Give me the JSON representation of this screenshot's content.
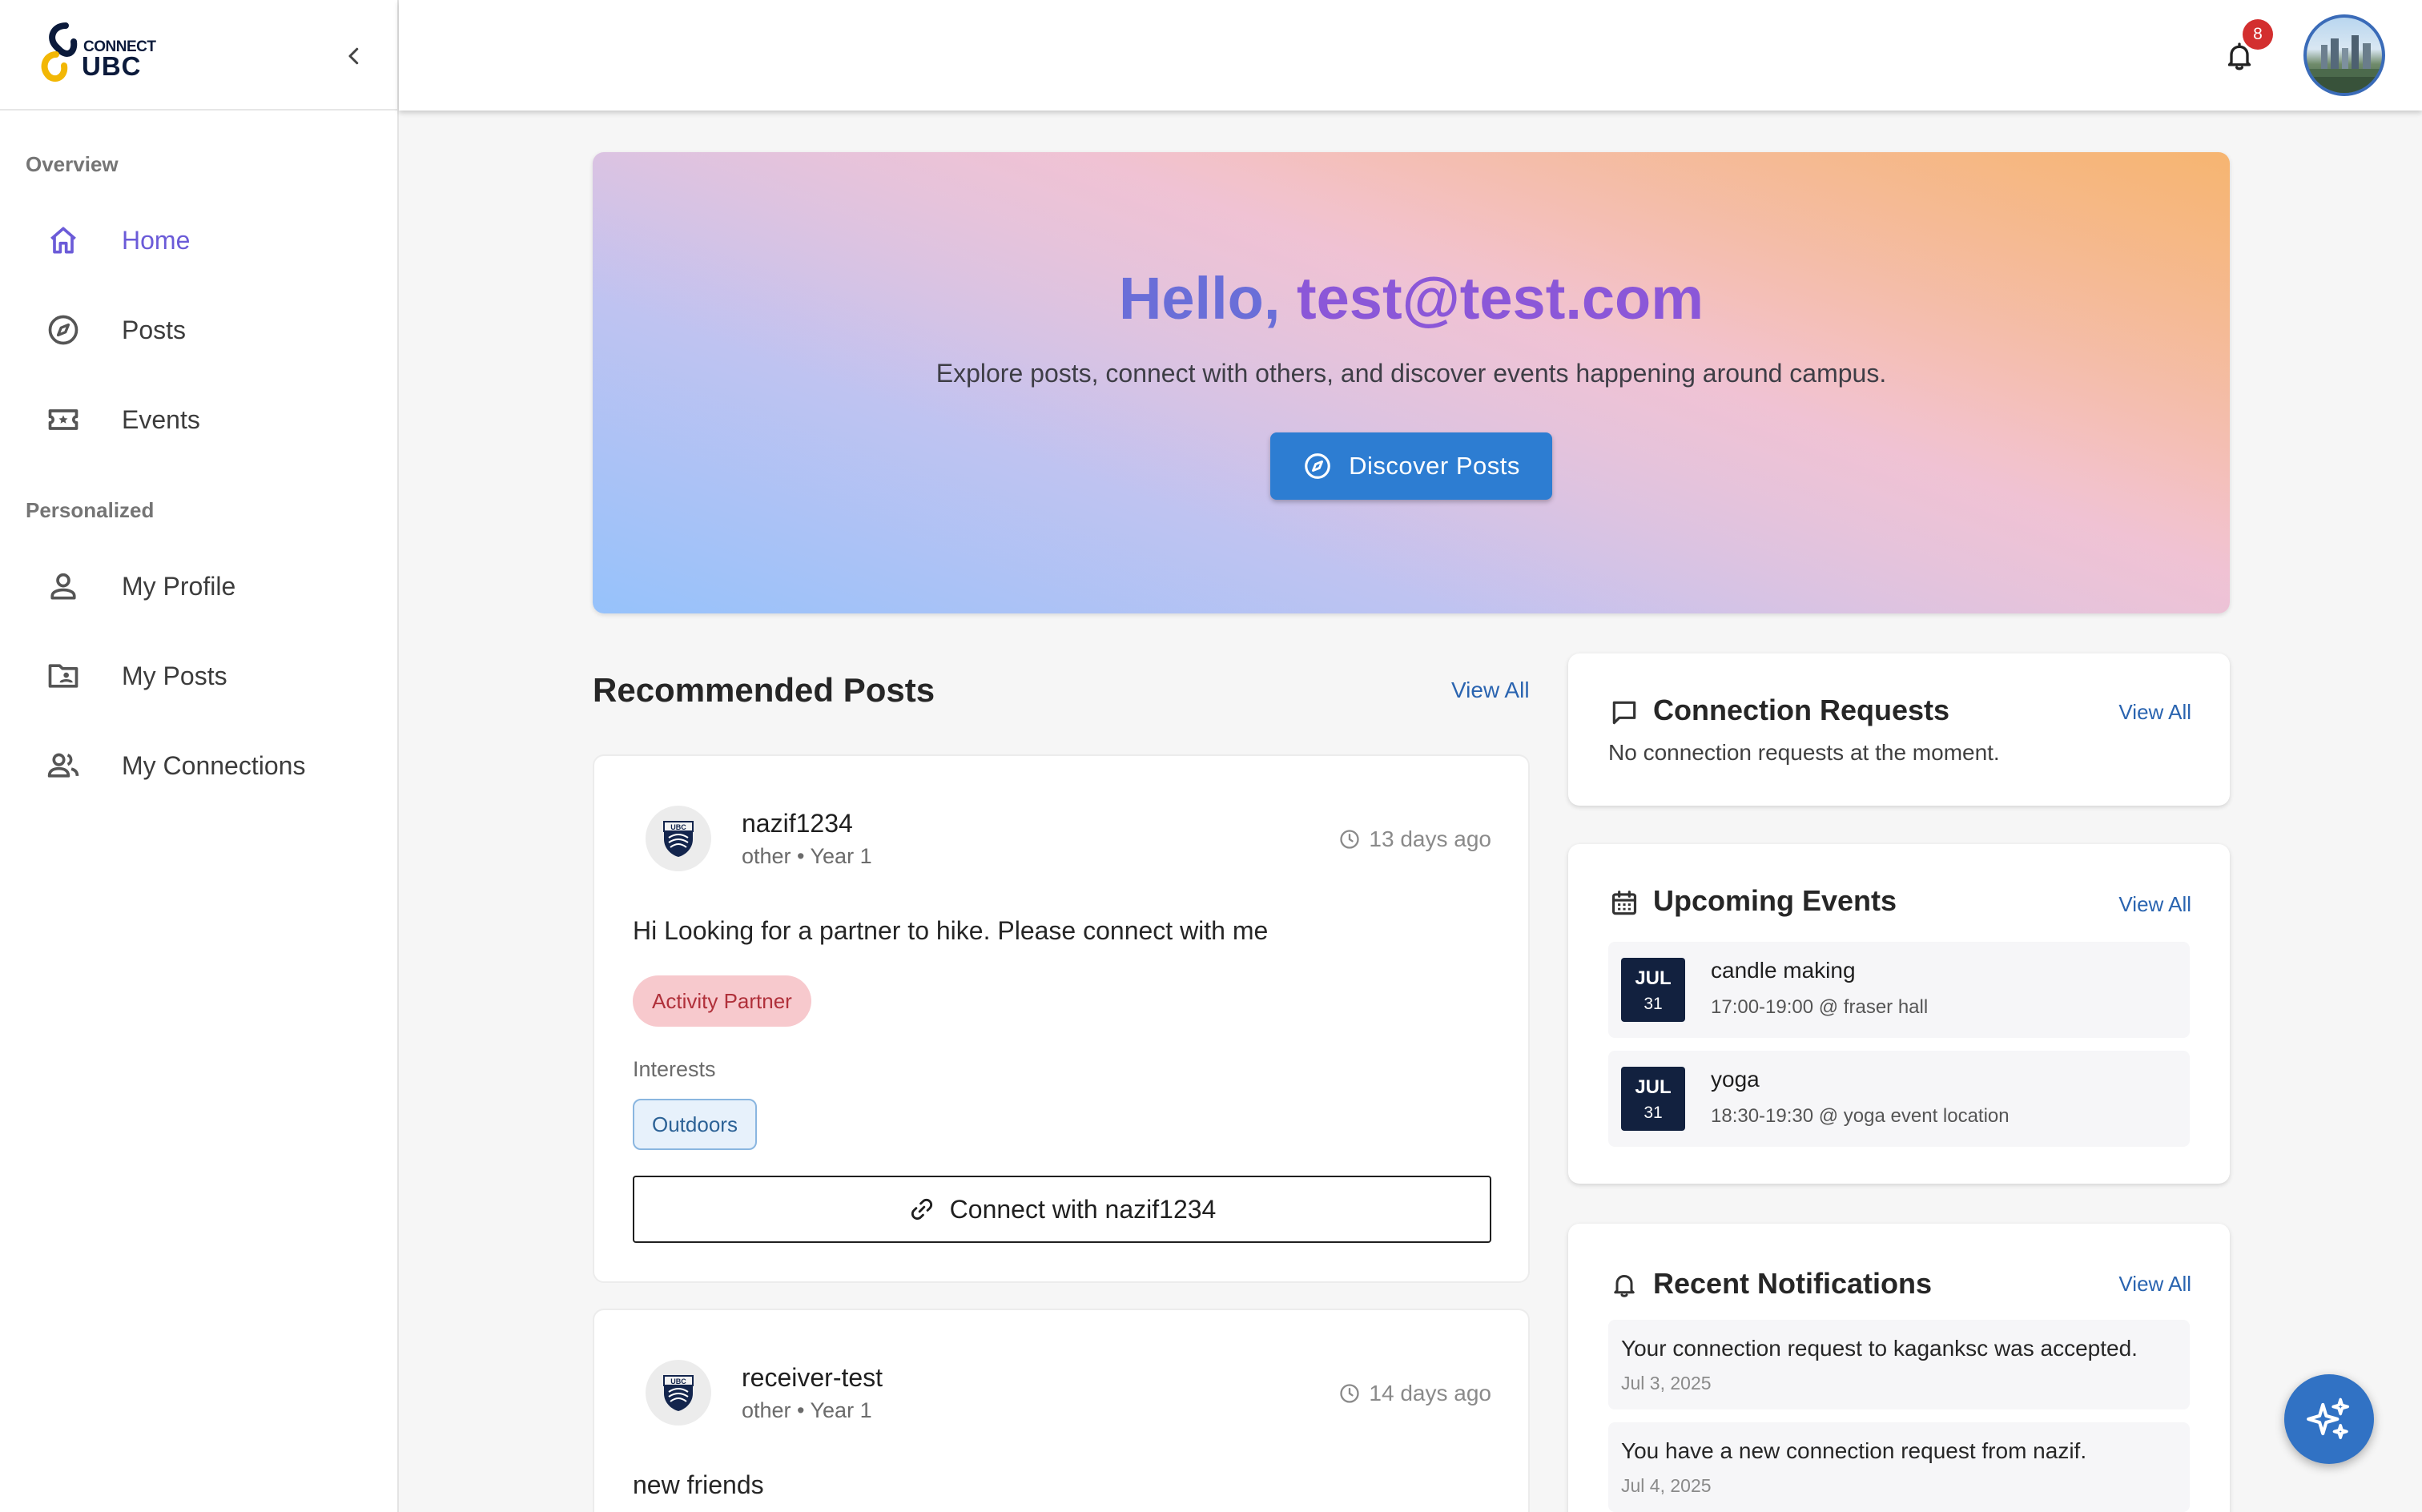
{
  "brand": {
    "line1": "CONNECT",
    "line2": "UBC"
  },
  "sidebar": {
    "sections": [
      {
        "title": "Overview"
      },
      {
        "title": "Personalized"
      }
    ],
    "items": [
      {
        "label": "Home",
        "icon": "home-icon",
        "active": true
      },
      {
        "label": "Posts",
        "icon": "compass-icon"
      },
      {
        "label": "Events",
        "icon": "ticket-icon"
      },
      {
        "label": "My Profile",
        "icon": "person-icon"
      },
      {
        "label": "My Posts",
        "icon": "folder-user-icon"
      },
      {
        "label": "My Connections",
        "icon": "people-icon"
      }
    ]
  },
  "topbar": {
    "notification_count": "8"
  },
  "hero": {
    "greeting": "Hello,",
    "email": "test@test.com",
    "subtitle": "Explore posts, connect with others, and discover events happening around campus.",
    "button_label": "Discover Posts"
  },
  "recommended": {
    "title": "Recommended Posts",
    "view_all": "View All",
    "posts": [
      {
        "username": "nazif1234",
        "meta": "other • Year 1",
        "time": "13 days ago",
        "body": "Hi Looking for a partner to hike. Please connect with me",
        "tag": "Activity Partner",
        "interests_label": "Interests",
        "interests": [
          "Outdoors"
        ],
        "connect_label": "Connect with nazif1234"
      },
      {
        "username": "receiver-test",
        "meta": "other • Year 1",
        "time": "14 days ago",
        "body": "new friends"
      }
    ]
  },
  "connection_requests": {
    "title": "Connection Requests",
    "view_all": "View All",
    "empty_text": "No connection requests at the moment."
  },
  "upcoming_events": {
    "title": "Upcoming Events",
    "view_all": "View All",
    "items": [
      {
        "month": "JUL",
        "day": "31",
        "name": "candle making",
        "when": "17:00-19:00 @ fraser hall"
      },
      {
        "month": "JUL",
        "day": "31",
        "name": "yoga",
        "when": "18:30-19:30 @ yoga event location"
      }
    ]
  },
  "notifications": {
    "title": "Recent Notifications",
    "view_all": "View All",
    "items": [
      {
        "text": "Your connection request to kaganksc was accepted.",
        "date": "Jul 3, 2025"
      },
      {
        "text": "You have a new connection request from nazif.",
        "date": "Jul 4, 2025"
      }
    ]
  },
  "colors": {
    "accent": "#2d7dd2",
    "active_nav": "#6b5bd8",
    "tag_bg": "#f7c9cd",
    "tag_text": "#b0303a",
    "event_date_bg": "#12213f",
    "badge": "#d32f2f"
  }
}
